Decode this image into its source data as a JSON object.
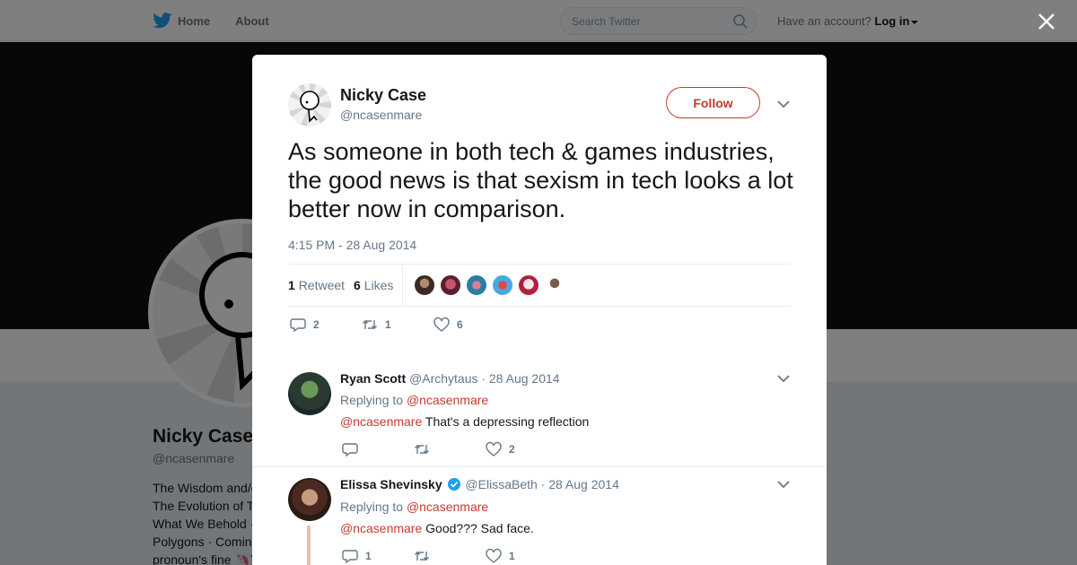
{
  "topbar": {
    "home_label": "Home",
    "about_label": "About",
    "search_placeholder": "Search Twitter",
    "account_prompt": "Have an account?",
    "login_label": "Log in"
  },
  "background_profile": {
    "name": "Nicky Case",
    "handle": "@ncasenmare",
    "bio_lines": [
      "The Wisdom and/o",
      "The Evolution of T",
      "What We Behold ·",
      "Polygons · Comin",
      "pronoun's fine 🦄)"
    ]
  },
  "tweet": {
    "author_name": "Nicky Case",
    "author_handle": "@ncasenmare",
    "follow_label": "Follow",
    "text": "As someone in both tech & games industries, the good news is that sexism in tech looks a lot better now in comparison.",
    "timestamp": "4:15 PM - 28 Aug 2014",
    "retweet_count": "1",
    "retweet_label": "Retweet",
    "like_count": "6",
    "like_label": "Likes",
    "actions": {
      "reply": "2",
      "retweet": "1",
      "like": "6"
    }
  },
  "replies": [
    {
      "name": "Ryan Scott",
      "handle": "@Archytaus",
      "date": "· 28 Aug 2014",
      "replying_to_label": "Replying to",
      "replying_to": "@ncasenmare",
      "mention": "@ncasenmare",
      "text": " That's a depressing reflection",
      "actions": {
        "reply": "",
        "retweet": "",
        "like": "2"
      }
    },
    {
      "name": "Elissa Shevinsky",
      "handle": "@ElissaBeth",
      "date": "· 28 Aug 2014",
      "replying_to_label": "Replying to",
      "replying_to": "@ncasenmare",
      "mention": "@ncasenmare",
      "text": " Good??? Sad face.",
      "actions": {
        "reply": "1",
        "retweet": "",
        "like": "1"
      }
    }
  ],
  "colors": {
    "accent": "#c63a2f",
    "twitter_blue": "#1da1f2",
    "muted": "#657786"
  }
}
